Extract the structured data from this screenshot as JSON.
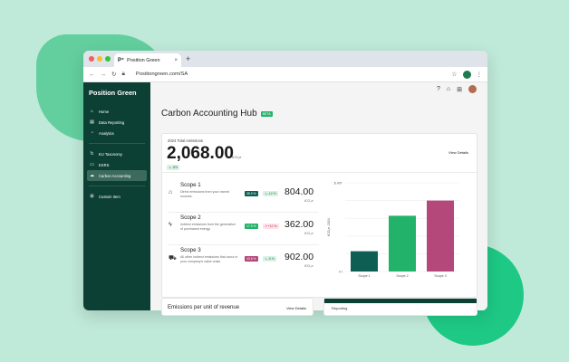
{
  "browser": {
    "tab_favicon": "P⁺",
    "tab_title": "Position Green",
    "tab_close": "×",
    "new_tab": "+",
    "url": "Positiongreen.com/SA",
    "traffic_colors": [
      "#f25f57",
      "#f6be2f",
      "#2ec840"
    ]
  },
  "sidebar": {
    "brand": "Position Green",
    "items_top": [
      {
        "label": "Home",
        "icon": "home-icon",
        "glyph": "⌂"
      },
      {
        "label": "Data Reporting",
        "icon": "document-icon",
        "glyph": "▤"
      },
      {
        "label": "Analytics",
        "icon": "analytics-icon",
        "glyph": "◔"
      }
    ],
    "items_bottom": [
      {
        "label": "EU Taxonomy",
        "icon": "refresh-icon",
        "glyph": "↻"
      },
      {
        "label": "ESRS",
        "icon": "esrs-icon",
        "glyph": "▭"
      },
      {
        "label": "Carbon Accounting",
        "icon": "cloud-icon",
        "glyph": "☁",
        "active": true
      }
    ],
    "items_extra": [
      {
        "label": "Custom Item",
        "icon": "custom-icon",
        "glyph": "⊞"
      }
    ]
  },
  "header": {
    "title": "Carbon Accounting Hub",
    "badge": "BETA"
  },
  "totals": {
    "label": "2024 Total emissions",
    "value": "2,068.00",
    "unit": "tCO₂e",
    "trend": "↘ -8%",
    "view_details": "View Details"
  },
  "scopes": [
    {
      "name": "Scope 1",
      "desc": "Direct emissions from your owned sources.",
      "pct": "38.9 %",
      "pct_color": "#0e5e53",
      "trend": "↘ -12 %",
      "trend_bg": "#daf1e4",
      "trend_color": "#1a7a46",
      "value": "804.00",
      "unit": "tCO₂e",
      "icon": "factory-icon",
      "glyph": "⌂"
    },
    {
      "name": "Scope 2",
      "desc": "Indirect emissions from the generation of purchased energy.",
      "pct": "17.5 %",
      "pct_color": "#23b26a",
      "trend": "↗ +10 %",
      "trend_bg": "#fde3e8",
      "trend_color": "#b53058",
      "value": "362.00",
      "unit": "tCO₂e",
      "icon": "energy-icon",
      "glyph": "ϟ"
    },
    {
      "name": "Scope 3",
      "desc": "All other indirect emissions that occur in your company's value chain.",
      "pct": "43.6 %",
      "pct_color": "#b4487a",
      "trend": "↘ -5 %",
      "trend_bg": "#daf1e4",
      "trend_color": "#1a7a46",
      "value": "902.00",
      "unit": "tCO₂e",
      "icon": "truck-icon",
      "glyph": "⛟"
    }
  ],
  "chart_data": {
    "type": "bar",
    "categories": [
      "Scope 1",
      "Scope 2",
      "Scope 3"
    ],
    "values": [
      160,
      440,
      560
    ],
    "colors": [
      "#0e5e53",
      "#23b26a",
      "#b4487a"
    ],
    "ylabel": "tCO₂e, 2024",
    "ytick_top": "$,40T",
    "ytick_bottom": "0 t",
    "ylim": [
      0,
      700
    ],
    "grid": true
  },
  "bottom": {
    "card1_title": "Emissions per unit of revenue",
    "card1_view": "View Details",
    "card2_title": "Reporting"
  }
}
